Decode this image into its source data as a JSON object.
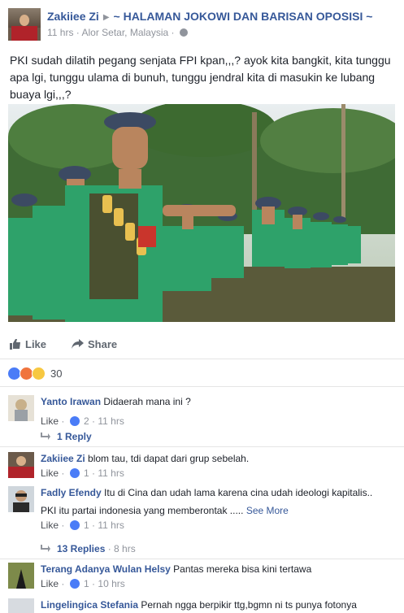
{
  "post": {
    "author": "Zakiiee Zi",
    "group": "~ HALAMAN JOKOWI DAN BARISAN OPOSISI ~",
    "time": "11 hrs",
    "location": "Alor Setar, Malaysia",
    "text": "PKI sudah dilatih pegang senjata FPI kpan,,,? ayok kita bangkit, kita tunggu apa lgi, tunggu ulama di bunuh, tunggu jendral kita di masukin ke lubang buaya lgi,,,?"
  },
  "actions": {
    "like": "Like",
    "share": "Share"
  },
  "reactions": {
    "count": "30",
    "types": [
      "like-icon",
      "angry-icon",
      "wow-icon"
    ]
  },
  "comments": [
    {
      "name": "Yanto Irawan",
      "text": "Didaerah mana ini ?",
      "like_label": "Like",
      "likes": "2",
      "time": "11 hrs",
      "replies": "1 Reply"
    },
    {
      "name": "Zakiiee Zi",
      "text": "blom tau, tdi dapat dari grup sebelah.",
      "like_label": "Like",
      "likes": "1",
      "time": "11 hrs"
    },
    {
      "name": "Fadly Efendy",
      "text": "Itu di Cina dan udah lama karena cina udah ideologi kapitalis..",
      "text2": "PKI itu partai indonesia yang memberontak .....",
      "see_more": "See More",
      "like_label": "Like",
      "likes": "1",
      "time": "11 hrs",
      "replies": "13 Replies",
      "replies_time": "8 hrs"
    },
    {
      "name": "Terang Adanya Wulan Helsy",
      "text": "Pantas mereka bisa kini tertawa",
      "like_label": "Like",
      "likes": "1",
      "time": "10 hrs"
    },
    {
      "name": "Lingelingica Stefania",
      "text": "Pernah ngga berpikir ttg,bgmn ni ts punya fotonya"
    }
  ],
  "colors": {
    "link": "#365899",
    "meta": "#90949c",
    "like_blue": "#4a7cf7"
  }
}
